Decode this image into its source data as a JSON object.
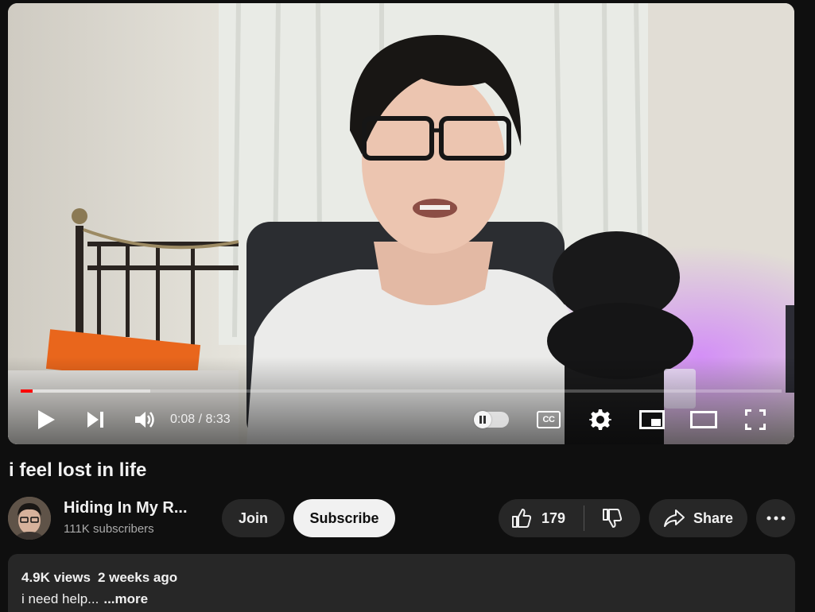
{
  "player": {
    "current_time": "0:08",
    "duration": "8:33",
    "time_separator": " / ",
    "progress_fraction": 0.016,
    "buffered_fraction": 0.17,
    "cc_label": "CC",
    "colors": {
      "progress": "#ff0000"
    }
  },
  "video": {
    "title": "i feel lost in life"
  },
  "channel": {
    "name": "Hiding In My R...",
    "subscribers": "111K subscribers",
    "join_label": "Join",
    "subscribe_label": "Subscribe"
  },
  "actions": {
    "like_count": "179",
    "share_label": "Share",
    "icons": [
      "thumbs-up-icon",
      "thumbs-down-icon",
      "share-arrow-icon",
      "more-dots-icon"
    ]
  },
  "description": {
    "views": "4.9K views",
    "age": "2 weeks ago",
    "snippet": "i need help...",
    "more_label": "...more"
  }
}
